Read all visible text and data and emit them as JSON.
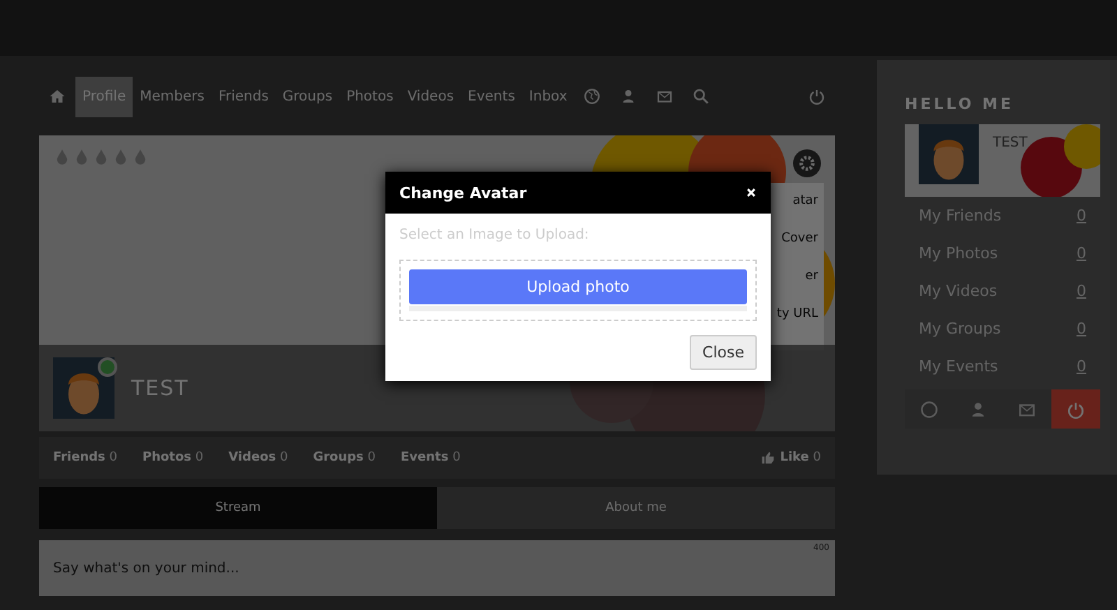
{
  "nav": {
    "items": [
      {
        "label": "Profile",
        "selected": true
      },
      {
        "label": "Members",
        "selected": false
      },
      {
        "label": "Friends",
        "selected": false
      },
      {
        "label": "Groups",
        "selected": false
      },
      {
        "label": "Photos",
        "selected": false
      },
      {
        "label": "Videos",
        "selected": false
      },
      {
        "label": "Events",
        "selected": false
      },
      {
        "label": "Inbox",
        "selected": false
      }
    ]
  },
  "profile": {
    "name": "TEST",
    "online": true,
    "menu_items": [
      "atar",
      "Cover",
      "er",
      "ty URL"
    ]
  },
  "stats": [
    {
      "label": "Friends",
      "count": "0"
    },
    {
      "label": "Photos",
      "count": "0"
    },
    {
      "label": "Videos",
      "count": "0"
    },
    {
      "label": "Groups",
      "count": "0"
    },
    {
      "label": "Events",
      "count": "0"
    }
  ],
  "like": {
    "label": "Like",
    "count": "0"
  },
  "tabs": [
    {
      "label": "Stream",
      "selected": true
    },
    {
      "label": "About me",
      "selected": false
    }
  ],
  "composer": {
    "placeholder": "Say what's on your mind...",
    "counter": "400"
  },
  "sidebar": {
    "title": "HELLO ME",
    "card_name": "TEST",
    "items": [
      {
        "label": "My Friends",
        "count": "0"
      },
      {
        "label": "My Photos",
        "count": "0"
      },
      {
        "label": "My Videos",
        "count": "0"
      },
      {
        "label": "My Groups",
        "count": "0"
      },
      {
        "label": "My Events",
        "count": "0"
      }
    ]
  },
  "modal": {
    "title": "Change Avatar",
    "prompt": "Select an Image to Upload:",
    "upload_button": "Upload photo",
    "progress": {
      "level": 0
    },
    "close_button": "Close"
  }
}
